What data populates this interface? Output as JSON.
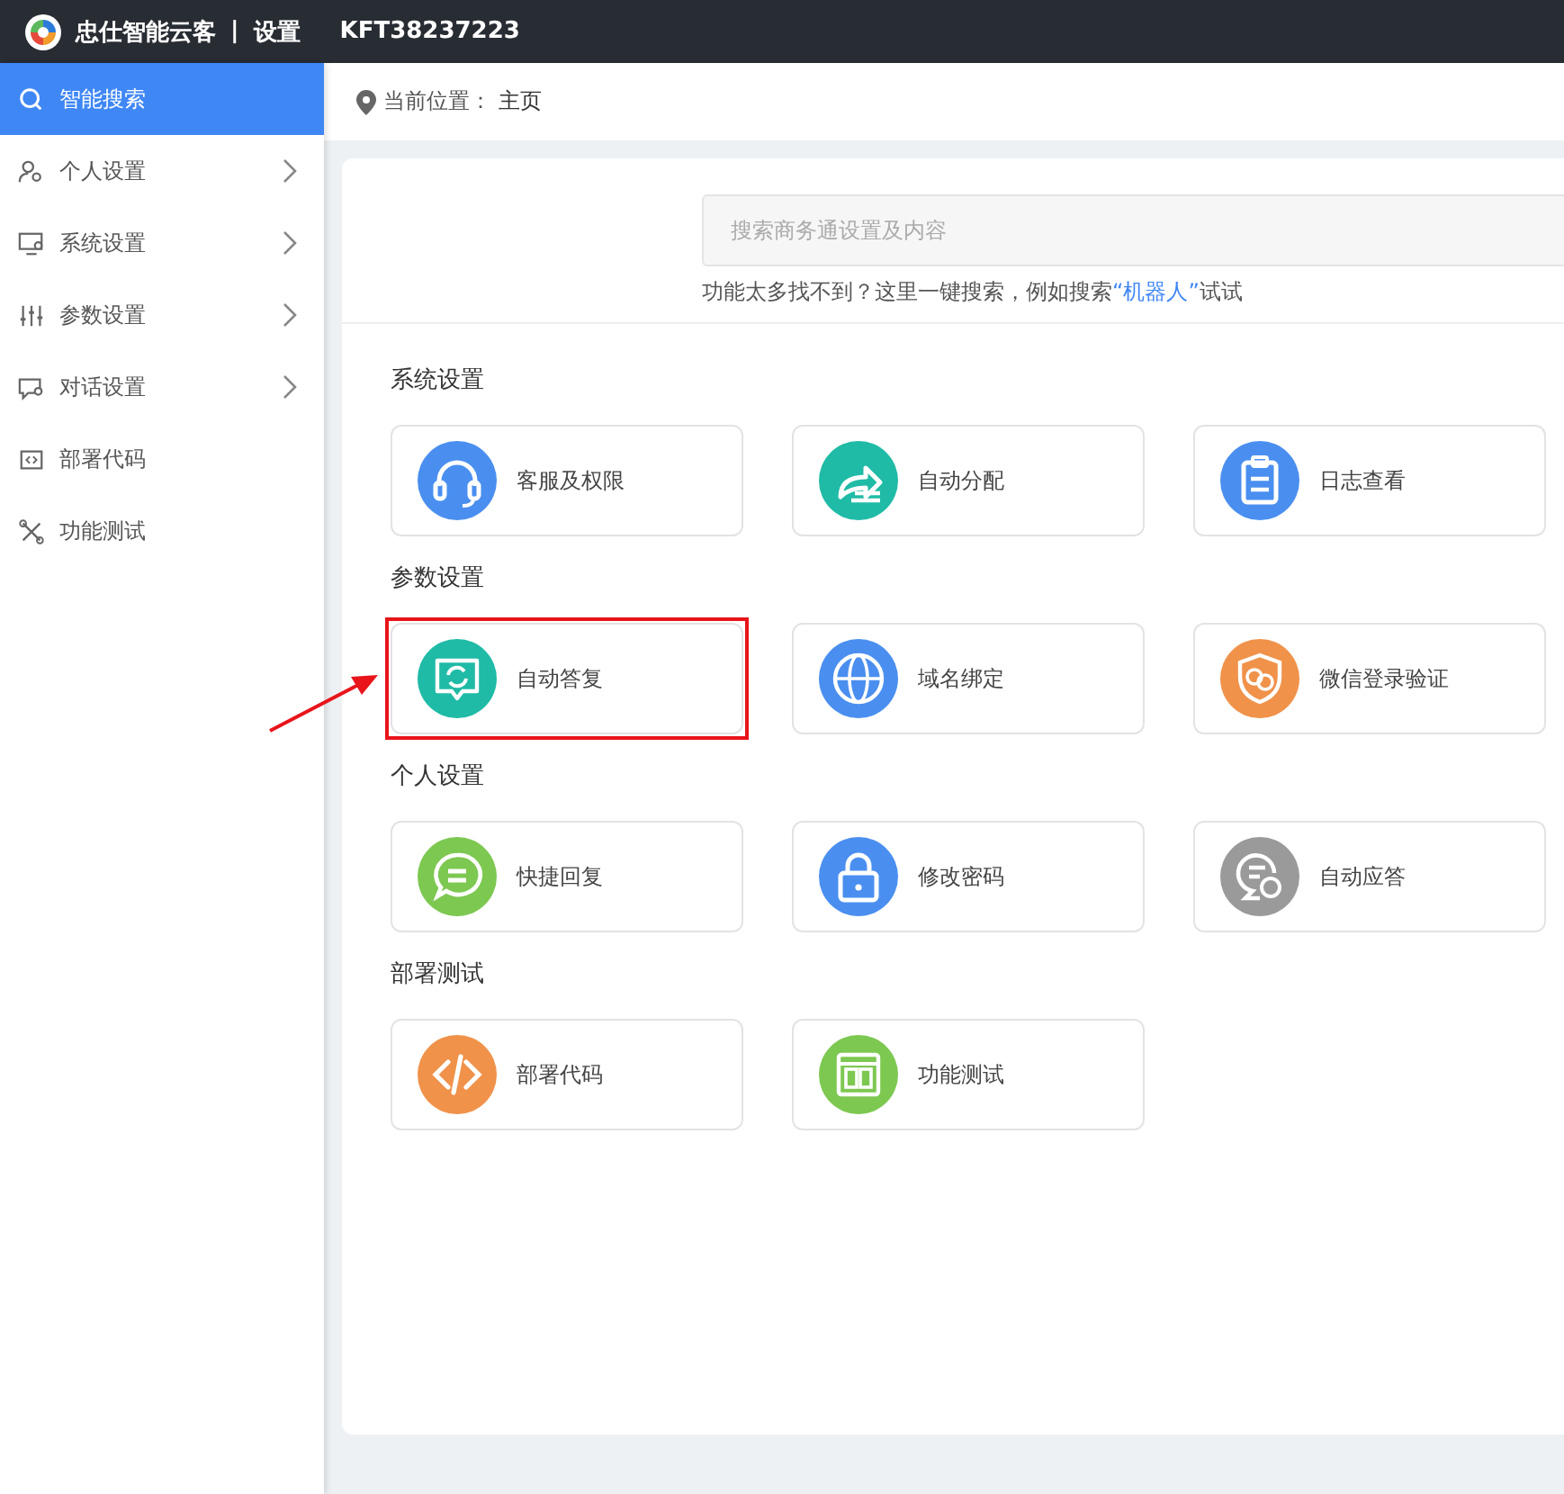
{
  "top_bar": {
    "title": "忠仕智能云客",
    "separator": "|",
    "section": "设置",
    "account": "KFT38237223"
  },
  "sidebar": {
    "items": [
      {
        "label": "智能搜索",
        "selected": true,
        "expandable": false
      },
      {
        "label": "个人设置",
        "selected": false,
        "expandable": true
      },
      {
        "label": "系统设置",
        "selected": false,
        "expandable": true
      },
      {
        "label": "参数设置",
        "selected": false,
        "expandable": true
      },
      {
        "label": "对话设置",
        "selected": false,
        "expandable": true
      },
      {
        "label": "部署代码",
        "selected": false,
        "expandable": false
      },
      {
        "label": "功能测试",
        "selected": false,
        "expandable": false
      }
    ]
  },
  "breadcrumb": {
    "label": "当前位置：",
    "current": "主页"
  },
  "search": {
    "placeholder": "搜索商务通设置及内容",
    "hint_before": "功能太多找不到？这里一键搜索，例如搜索",
    "hint_link": "“机器人”",
    "hint_after": "试试"
  },
  "sections": [
    {
      "title": "系统设置",
      "cards": [
        {
          "label": "客服及权限",
          "color": "#4a8ff0",
          "highlighted": false
        },
        {
          "label": "自动分配",
          "color": "#1fbba6",
          "highlighted": false
        },
        {
          "label": "日志查看",
          "color": "#4a8ff0",
          "highlighted": false
        }
      ]
    },
    {
      "title": "参数设置",
      "cards": [
        {
          "label": "自动答复",
          "color": "#1fbba6",
          "highlighted": true
        },
        {
          "label": "域名绑定",
          "color": "#4a8ff0",
          "highlighted": false
        },
        {
          "label": "微信登录验证",
          "color": "#f0924a",
          "highlighted": false
        }
      ]
    },
    {
      "title": "个人设置",
      "cards": [
        {
          "label": "快捷回复",
          "color": "#7dc851",
          "highlighted": false
        },
        {
          "label": "修改密码",
          "color": "#4a8ff0",
          "highlighted": false
        },
        {
          "label": "自动应答",
          "color": "#9a9a9a",
          "highlighted": false
        }
      ]
    },
    {
      "title": "部署测试",
      "cards": [
        {
          "label": "部署代码",
          "color": "#f0924a",
          "highlighted": false
        },
        {
          "label": "功能测试",
          "color": "#7dc851",
          "highlighted": false
        }
      ]
    }
  ]
}
